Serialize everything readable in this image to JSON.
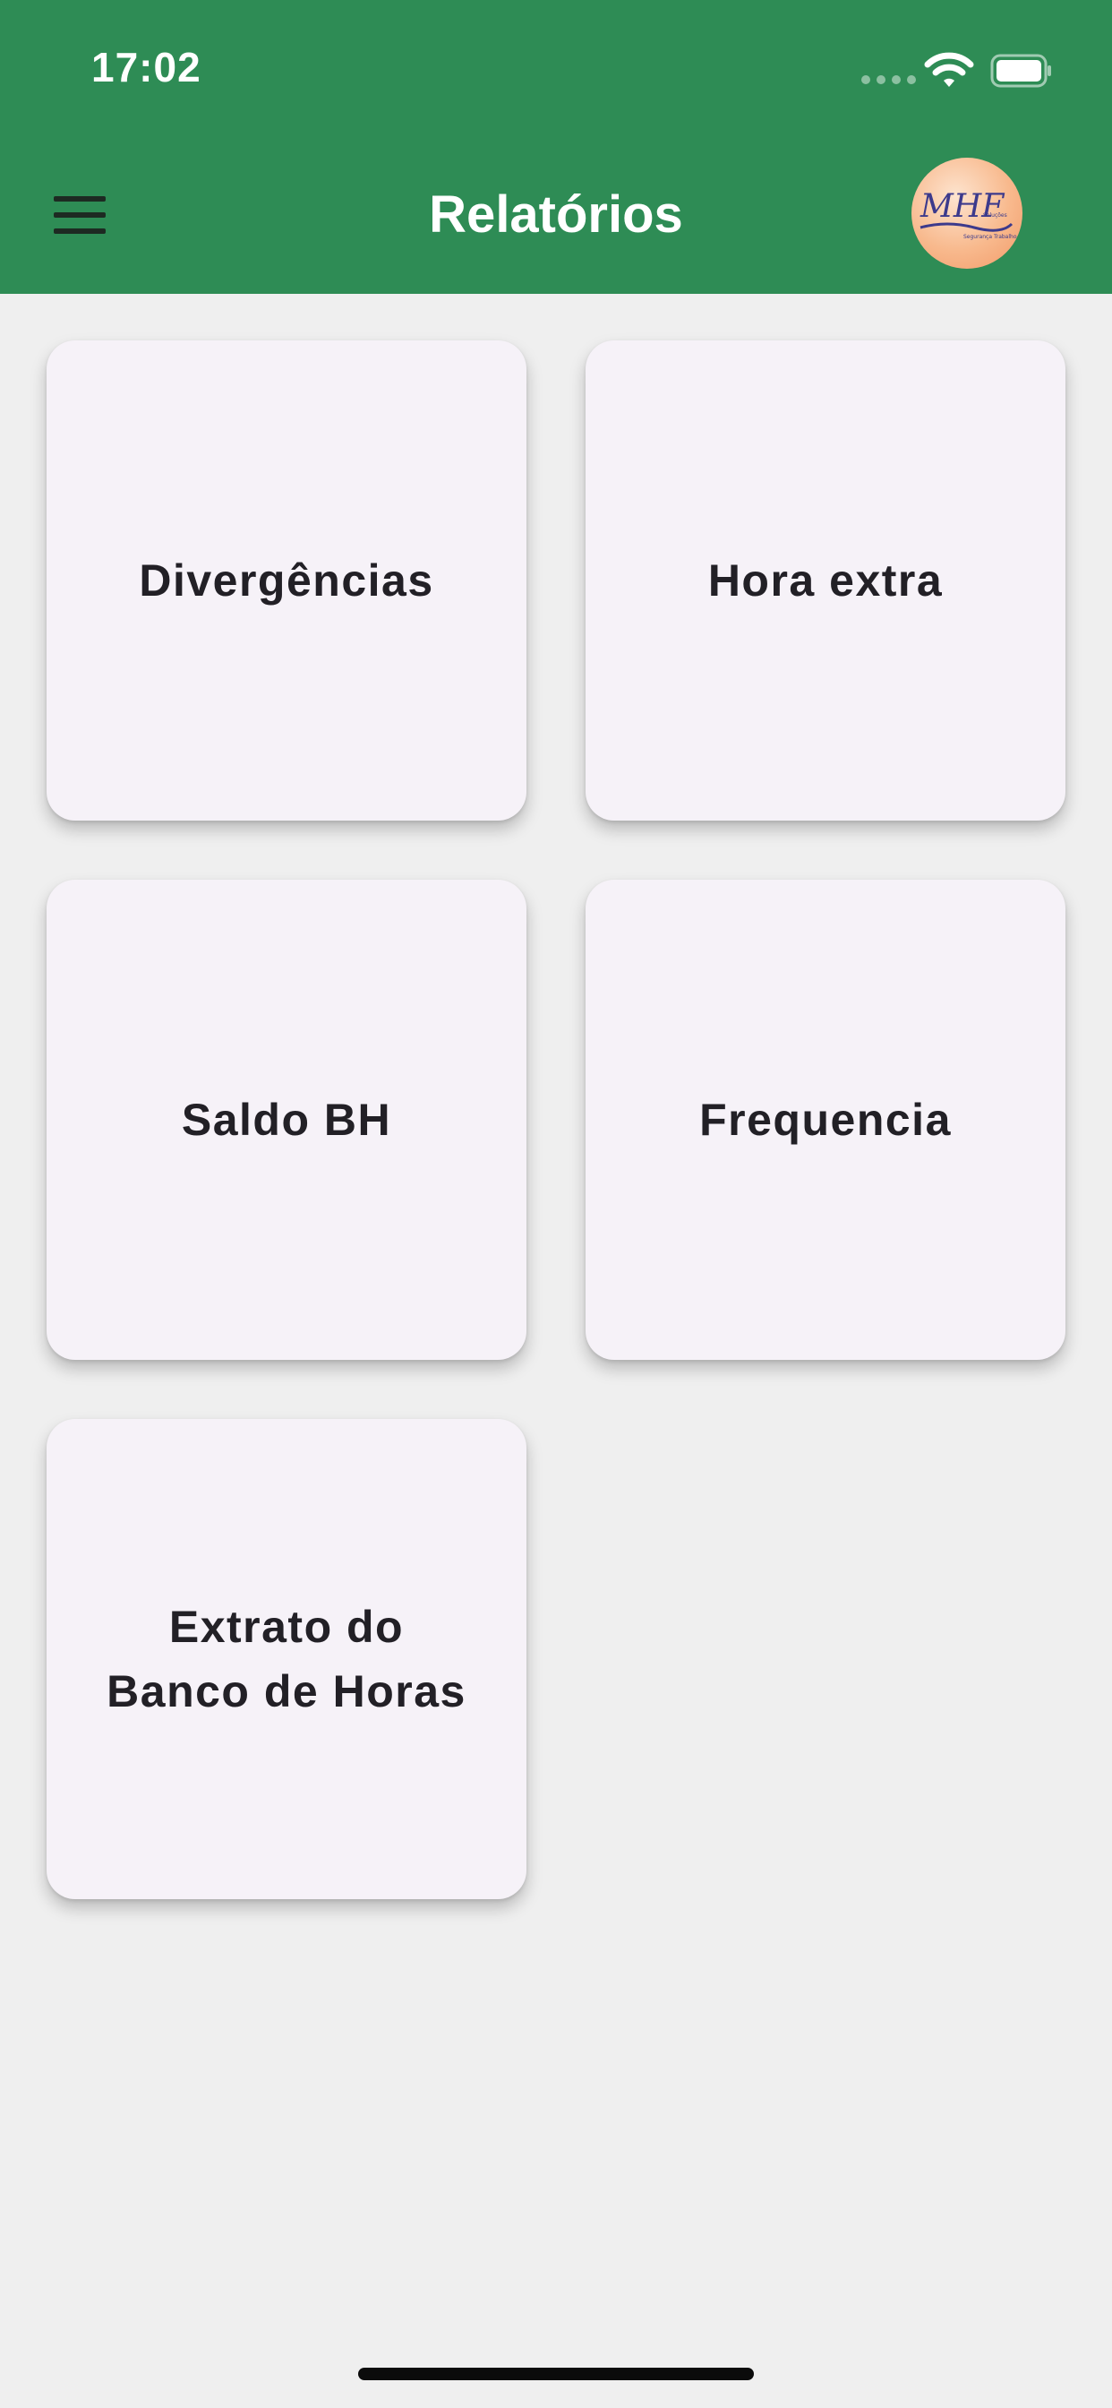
{
  "status_bar": {
    "time": "17:02"
  },
  "header": {
    "title": "Relatórios",
    "menu_icon": "hamburger-menu-icon",
    "avatar_logo_text": "MHF",
    "avatar_logo_subtext": "Soluções · Segurança Trabalho"
  },
  "tiles": [
    {
      "label": "Divergências"
    },
    {
      "label": "Hora extra"
    },
    {
      "label": "Saldo BH"
    },
    {
      "label": "Frequencia"
    },
    {
      "label_line1": "Extrato do",
      "label_line2": "Banco de Horas"
    }
  ],
  "colors": {
    "appbar": "#2e8c55",
    "background": "#efefef",
    "tile": "#f6f2f8",
    "tile_text": "#222026"
  }
}
